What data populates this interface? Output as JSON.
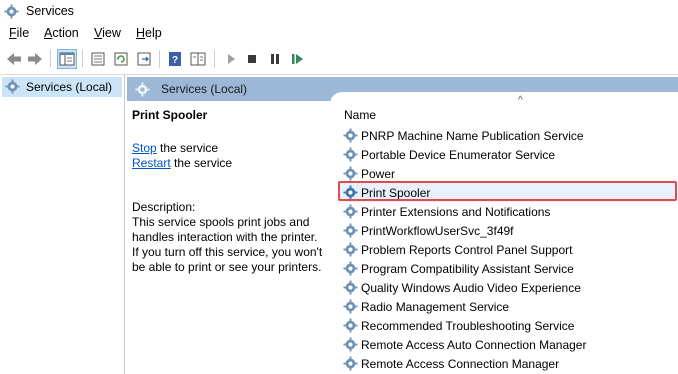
{
  "window": {
    "title": "Services"
  },
  "menu": {
    "file": "File",
    "action": "Action",
    "view": "View",
    "help": "Help",
    "file_u": "F",
    "file_rest": "ile",
    "action_u": "A",
    "action_rest": "ction",
    "view_u": "V",
    "view_rest": "iew",
    "help_u": "H",
    "help_rest": "elp"
  },
  "toolbar": {
    "icons": [
      "back-arrow-icon",
      "forward-arrow-icon",
      "show-hide-console-tree-icon",
      "properties-icon",
      "refresh-icon",
      "export-list-icon",
      "help-icon",
      "extended-view-icon",
      "start-service-icon",
      "stop-service-icon",
      "pause-service-icon",
      "restart-service-icon"
    ]
  },
  "tree": {
    "root_label": "Services (Local)"
  },
  "pane": {
    "header": "Services (Local)"
  },
  "details": {
    "service_name": "Print Spooler",
    "stop_link": "Stop",
    "stop_suffix": " the service",
    "restart_link": "Restart",
    "restart_suffix": " the service",
    "description_label": "Description:",
    "description_lines": [
      "This service spools print jobs and",
      "handles interaction with the printer.",
      "If you turn off this service, you won't",
      "be able to print or see your printers."
    ]
  },
  "list": {
    "column_name": "Name",
    "sort_indicator": "^",
    "rows": [
      "PNRP Machine Name Publication Service",
      "Portable Device Enumerator Service",
      "Power",
      "Print Spooler",
      "Printer Extensions and Notifications",
      "PrintWorkflowUserSvc_3f49f",
      "Problem Reports Control Panel Support",
      "Program Compatibility Assistant Service",
      "Quality Windows Audio Video Experience",
      "Radio Management Service",
      "Recommended Troubleshooting Service",
      "Remote Access Auto Connection Manager",
      "Remote Access Connection Manager"
    ],
    "selected_row": "Print Spooler"
  },
  "colors": {
    "header_bg": "#9db8d6",
    "highlight_border": "#e14b4b",
    "link": "#0055cc",
    "selection": "#cce4f7"
  }
}
